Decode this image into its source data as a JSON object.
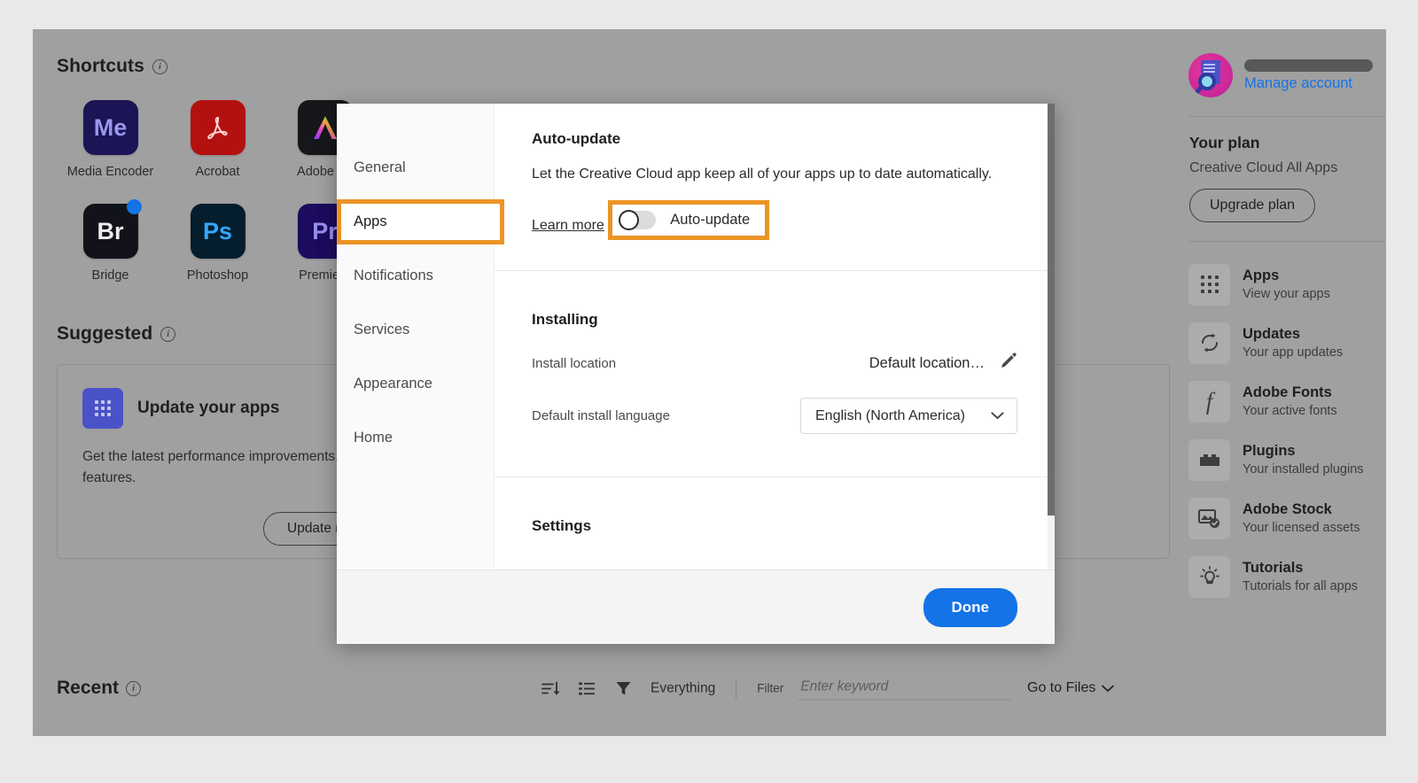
{
  "shortcuts": {
    "heading": "Shortcuts",
    "info_icon": "info-icon",
    "apps": [
      {
        "label": "Media Encoder",
        "abbr": "Me",
        "bg": "#1b1455",
        "fg": "#9999e8",
        "badge": false
      },
      {
        "label": "Acrobat",
        "abbr": "",
        "bg": "#b3110f",
        "fg": "#ffffff",
        "badge": false
      },
      {
        "label": "Adobe Ex",
        "abbr": "",
        "bg": "#16171b",
        "fg": "#ffffff",
        "badge": false
      },
      {
        "label": "Bridge",
        "abbr": "Br",
        "bg": "#12131a",
        "fg": "#eaeaea",
        "badge": true
      },
      {
        "label": "Photoshop",
        "abbr": "Ps",
        "bg": "#041e2e",
        "fg": "#31a8ff",
        "badge": false
      },
      {
        "label": "Premiere",
        "abbr": "Pr",
        "bg": "#1c0b5e",
        "fg": "#9a8df0",
        "badge": false
      }
    ]
  },
  "suggested": {
    "heading": "Suggested",
    "card_title": "Update your apps",
    "card_body": "Get the latest performance improvements, bug fixes, and app features.",
    "button_label": "Update now"
  },
  "recent": {
    "heading": "Recent",
    "sort_icon": "sort-descending-icon",
    "list_icon": "list-view-icon",
    "filter_icon": "funnel-icon",
    "everything_label": "Everything",
    "filter_label": "Filter",
    "filter_placeholder": "Enter keyword",
    "filter_value": "",
    "go_to_files": "Go to Files"
  },
  "sidebar": {
    "avatar": "user-avatar",
    "account_name_redacted": "",
    "manage_account": "Manage account",
    "plan_title": "Your plan",
    "plan_name": "Creative Cloud All Apps",
    "upgrade_button": "Upgrade plan",
    "nav": [
      {
        "title": "Apps",
        "sub": "View your apps",
        "icon": "apps-grid-icon"
      },
      {
        "title": "Updates",
        "sub": "Your app updates",
        "icon": "refresh-icon"
      },
      {
        "title": "Adobe Fonts",
        "sub": "Your active fonts",
        "icon": "font-f-icon"
      },
      {
        "title": "Plugins",
        "sub": "Your installed plugins",
        "icon": "plugin-brick-icon"
      },
      {
        "title": "Adobe Stock",
        "sub": "Your licensed assets",
        "icon": "stock-image-icon"
      },
      {
        "title": "Tutorials",
        "sub": "Tutorials for all apps",
        "icon": "lightbulb-icon"
      }
    ]
  },
  "modal": {
    "nav_items": [
      {
        "label": "General",
        "active": false,
        "highlighted": false
      },
      {
        "label": "Apps",
        "active": true,
        "highlighted": true
      },
      {
        "label": "Notifications",
        "active": false,
        "highlighted": false
      },
      {
        "label": "Services",
        "active": false,
        "highlighted": false
      },
      {
        "label": "Appearance",
        "active": false,
        "highlighted": false
      },
      {
        "label": "Home",
        "active": false,
        "highlighted": false
      }
    ],
    "autoupdate": {
      "section_title": "Auto-update",
      "description": "Let the Creative Cloud app keep all of your apps up to date automatically.",
      "learn_more": "Learn more",
      "toggle_label": "Auto-update",
      "toggle_state": "off"
    },
    "installing": {
      "section_title": "Installing",
      "install_location_label": "Install location",
      "install_location_value": "Default location…",
      "edit_icon": "pencil-icon",
      "language_label": "Default install language",
      "language_value": "English (North America)",
      "chevron_icon": "chevron-down-icon"
    },
    "settings": {
      "section_title": "Settings"
    },
    "footer": {
      "done_label": "Done"
    }
  },
  "colors": {
    "highlight_orange": "#eb9426",
    "accent_blue": "#1473e6",
    "app_bg_gray": "#a0a0a0",
    "modal_white": "#ffffff",
    "scrollbar_gray": "#6e6e6e"
  }
}
